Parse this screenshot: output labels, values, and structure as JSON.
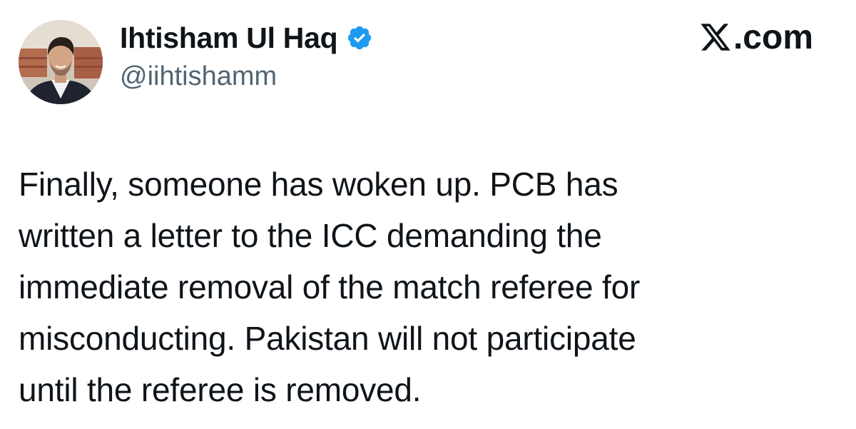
{
  "author": {
    "display_name": "Ihtisham Ul Haq",
    "handle": "@iihtishamm",
    "verified": true,
    "verified_color": "#1d9bf0",
    "avatar_icon": "profile-photo"
  },
  "site": {
    "logo_icon": "x-logo-icon",
    "suffix": ".com"
  },
  "tweet": {
    "text": "Finally, someone has woken up. PCB has\nwritten a letter to the ICC demanding the\nimmediate removal of the match referee for\nmisconducting. Pakistan will not participate\nuntil the referee is removed."
  },
  "colors": {
    "text_primary": "#0f1419",
    "text_secondary": "#536471",
    "background": "#ffffff"
  }
}
